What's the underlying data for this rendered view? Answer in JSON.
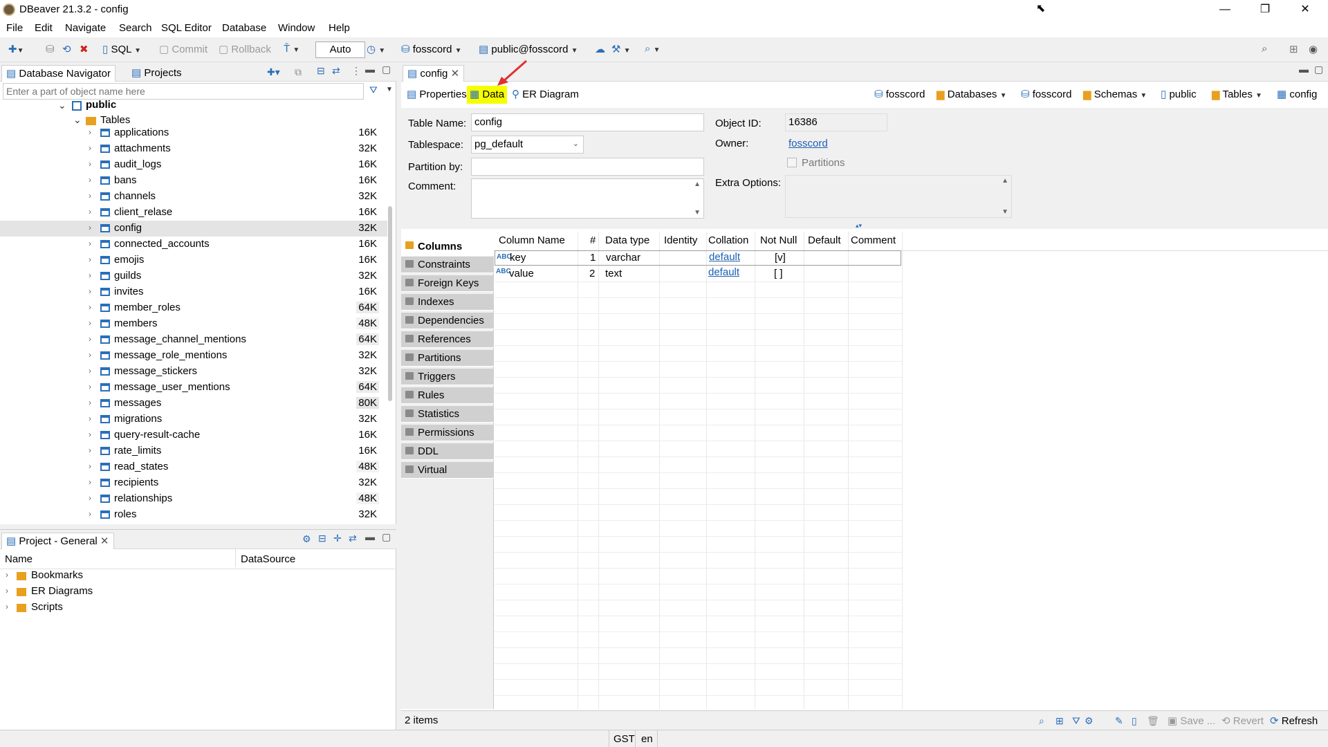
{
  "window": {
    "title": "DBeaver 21.3.2 - config",
    "minimize": "—",
    "maximize": "❐",
    "close": "✕"
  },
  "menu": [
    "File",
    "Edit",
    "Navigate",
    "Search",
    "SQL Editor",
    "Database",
    "Window",
    "Help"
  ],
  "toolbar": {
    "sql_label": "SQL",
    "commit_label": "Commit",
    "rollback_label": "Rollback",
    "auto_label": "Auto",
    "connection_label": "fosscord",
    "schema_label": "public@fosscord"
  },
  "navigator": {
    "tab_db": "Database Navigator",
    "tab_projects": "Projects",
    "filter_placeholder": "Enter a part of object name here",
    "schema": "public",
    "tables_folder": "Tables",
    "tables": [
      {
        "name": "applications",
        "size": "16K"
      },
      {
        "name": "attachments",
        "size": "32K"
      },
      {
        "name": "audit_logs",
        "size": "16K"
      },
      {
        "name": "bans",
        "size": "16K"
      },
      {
        "name": "channels",
        "size": "32K"
      },
      {
        "name": "client_relase",
        "size": "16K"
      },
      {
        "name": "config",
        "size": "32K"
      },
      {
        "name": "connected_accounts",
        "size": "16K"
      },
      {
        "name": "emojis",
        "size": "16K"
      },
      {
        "name": "guilds",
        "size": "32K"
      },
      {
        "name": "invites",
        "size": "16K"
      },
      {
        "name": "member_roles",
        "size": "64K"
      },
      {
        "name": "members",
        "size": "48K"
      },
      {
        "name": "message_channel_mentions",
        "size": "64K"
      },
      {
        "name": "message_role_mentions",
        "size": "32K"
      },
      {
        "name": "message_stickers",
        "size": "32K"
      },
      {
        "name": "message_user_mentions",
        "size": "64K"
      },
      {
        "name": "messages",
        "size": "80K"
      },
      {
        "name": "migrations",
        "size": "32K"
      },
      {
        "name": "query-result-cache",
        "size": "16K"
      },
      {
        "name": "rate_limits",
        "size": "16K"
      },
      {
        "name": "read_states",
        "size": "48K"
      },
      {
        "name": "recipients",
        "size": "32K"
      },
      {
        "name": "relationships",
        "size": "48K"
      },
      {
        "name": "roles",
        "size": "32K"
      }
    ]
  },
  "project": {
    "tab": "Project - General",
    "col_name": "Name",
    "col_datasource": "DataSource",
    "items": [
      "Bookmarks",
      "ER Diagrams",
      "Scripts"
    ]
  },
  "editor": {
    "tab": "config",
    "subtabs": {
      "properties": "Properties",
      "data": "Data",
      "er": "ER Diagram"
    },
    "breadcrumb": [
      "fosscord",
      "Databases",
      "fosscord",
      "Schemas",
      "public",
      "Tables",
      "config"
    ],
    "table_name_label": "Table Name:",
    "table_name": "config",
    "tablespace_label": "Tablespace:",
    "tablespace": "pg_default",
    "partition_label": "Partition by:",
    "comment_label": "Comment:",
    "object_id_label": "Object ID:",
    "object_id": "16386",
    "owner_label": "Owner:",
    "owner": "fosscord",
    "partitions_label": "Partitions",
    "extra_options_label": "Extra Options:",
    "side_tabs": [
      "Columns",
      "Constraints",
      "Foreign Keys",
      "Indexes",
      "Dependencies",
      "References",
      "Partitions",
      "Triggers",
      "Rules",
      "Statistics",
      "Permissions",
      "DDL",
      "Virtual"
    ],
    "columns_header": [
      "Column Name",
      "#",
      "Data type",
      "Identity",
      "Collation",
      "Not Null",
      "Default",
      "Comment"
    ],
    "columns": [
      {
        "name": "key",
        "num": "1",
        "type": "varchar",
        "identity": "",
        "collation": "default",
        "not_null": "[v]",
        "default": "",
        "comment": ""
      },
      {
        "name": "value",
        "num": "2",
        "type": "text",
        "identity": "",
        "collation": "default",
        "not_null": "[ ]",
        "default": "",
        "comment": ""
      }
    ],
    "status_items": "2 items",
    "save": "Save ...",
    "revert": "Revert",
    "refresh": "Refresh"
  },
  "statusbar": {
    "tz": "GST",
    "lang": "en"
  },
  "colors": {
    "highlight": "#f6ff00",
    "accent": "#2a6eb8",
    "link": "#1a5fb4",
    "arrow": "#e03030"
  }
}
